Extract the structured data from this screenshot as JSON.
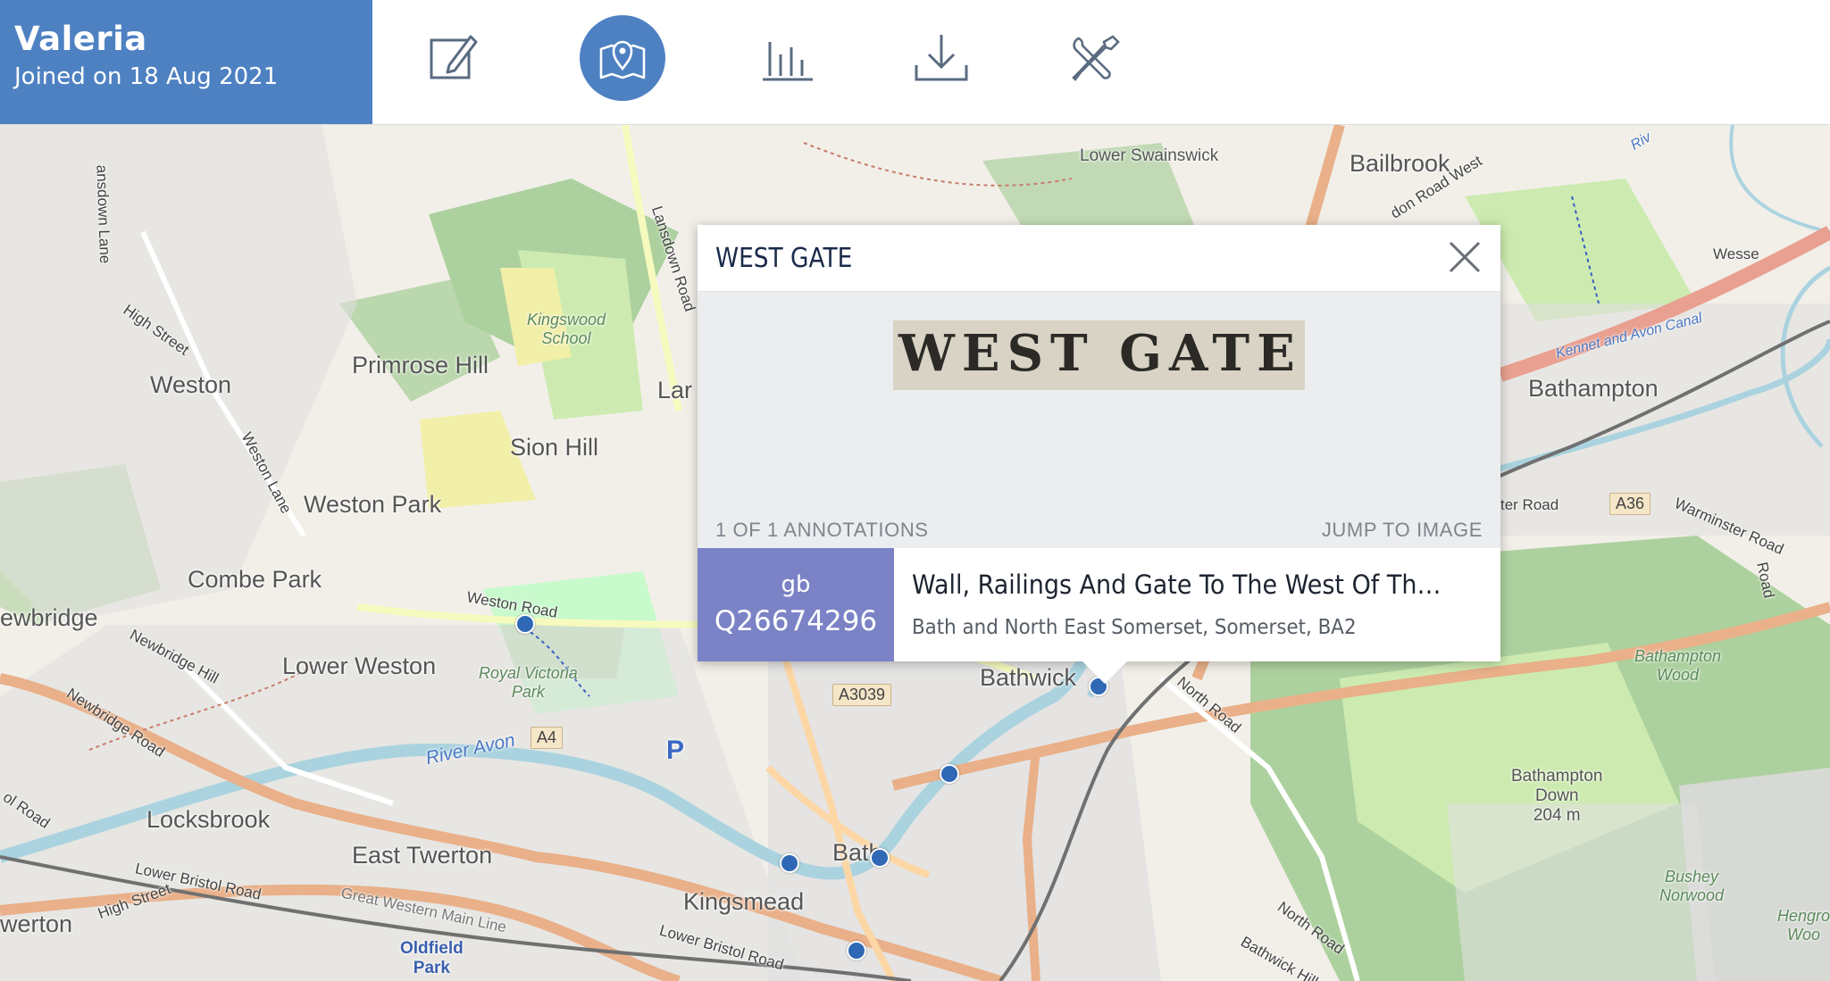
{
  "user": {
    "name": "Valeria",
    "joined": "Joined on 18 Aug 2021"
  },
  "nav": [
    {
      "id": "annotate",
      "icon": "edit-icon",
      "active": false
    },
    {
      "id": "map",
      "icon": "map-pin-icon",
      "active": true
    },
    {
      "id": "stats",
      "icon": "bar-chart-icon",
      "active": false
    },
    {
      "id": "download",
      "icon": "download-icon",
      "active": false
    },
    {
      "id": "tools",
      "icon": "tools-icon",
      "active": false
    }
  ],
  "popup": {
    "title": "WEST GATE",
    "snippet_text": "WEST GATE",
    "annotation_count": "1 OF 1 ANNOTATIONS",
    "jump_label": "JUMP TO IMAGE",
    "record": {
      "country": "gb",
      "id": "Q26674296",
      "title": "Wall, Railings And Gate To The West Of The Kennet A...",
      "subtitle": "Bath and North East Somerset, Somerset, BA2"
    }
  },
  "map": {
    "places": {
      "lower_swainswick": "Lower Swainswick",
      "bailbrook": "Bailbrook",
      "primrose_hill": "Primrose Hill",
      "kingswood_school": "Kingswood\nSchool",
      "weston": "Weston",
      "sion_hill": "Sion Hill",
      "weston_park": "Weston Park",
      "combe_park": "Combe Park",
      "newbridge": "ewbridge",
      "lower_weston": "Lower Weston",
      "royal_victoria_park": "Royal Victoria\nPark",
      "locksbrook": "Locksbrook",
      "east_twerton": "East Twerton",
      "kingsmead": "Kingsmead",
      "bath": "Bath",
      "twerton": "werton",
      "oldfield_park": "Oldfield\nPark",
      "bathwick": "Bathwick",
      "bathampton": "Bathampton",
      "bathampton_wood": "Bathampton\nWood",
      "bathampton_down": "Bathampton\nDown\n204 m",
      "bushey_norwood": "Bushey\nNorwood",
      "hengrove_wood": "Hengro\nWoo",
      "lansdown_partial": "Lar",
      "wessex": "Wesse"
    },
    "roads": {
      "lansdown_lane": "ansdown Lane",
      "high_street_1": "High Street",
      "lansdown_road": "Lansdown Road",
      "weston_lane": "Weston Lane",
      "weston_road": "Weston Road",
      "newbridge_hill": "Newbridge Hill",
      "newbridge_road": "Newbridge Road",
      "lower_bristol_road_1": "Lower Bristol Road",
      "lower_bristol_road_2": "Lower Bristol Road",
      "high_street_2": "High Street",
      "gw_main_line": "Great Western Main Line",
      "ol_road": "ol Road",
      "london_road_west": "don Road West",
      "north_road_1": "North Road",
      "north_road_2": "North Road",
      "bathwick_hill": "Bathwick Hill",
      "warminster_road": "Warminster Road",
      "ter_road": "ter Road",
      "bathampton_road_edge": "Road",
      "kennet_avon_canal": "Kennet and Avon Canal",
      "river_avon": "River Avon",
      "riv": "Riv"
    },
    "shields": {
      "a4": "A4",
      "a3039": "A3039",
      "a36": "A36"
    },
    "parking": "P"
  }
}
